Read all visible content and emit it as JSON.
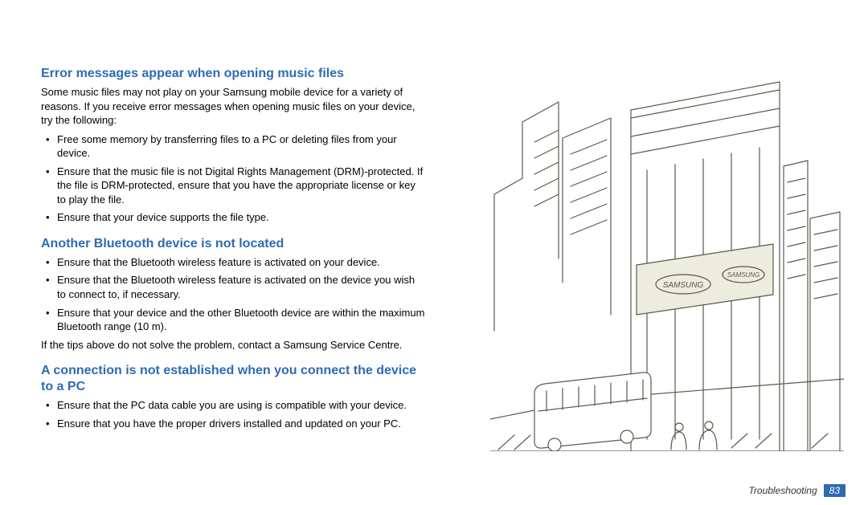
{
  "sections": {
    "s1": {
      "heading": "Error messages appear when opening music files",
      "intro": "Some music files may not play on your Samsung mobile device for a variety of reasons. If you receive error messages when opening music files on your device, try the following:",
      "bullets": [
        "Free some memory by transferring files to a PC or deleting files from your device.",
        "Ensure that the music file is not Digital Rights Management (DRM)-protected. If the file is DRM-protected, ensure that you have the appropriate license or key to play the file.",
        "Ensure that your device supports the file type."
      ]
    },
    "s2": {
      "heading": "Another Bluetooth device is not located",
      "bullets": [
        "Ensure that the Bluetooth wireless feature is activated on your device.",
        "Ensure that the Bluetooth wireless feature is activated on the device you wish to connect to, if necessary.",
        "Ensure that your device and the other Bluetooth device are within the maximum Bluetooth range (10 m)."
      ],
      "outro": "If the tips above do not solve the problem, contact a Samsung Service Centre."
    },
    "s3": {
      "heading": "A connection is not established when you connect the device to a PC",
      "bullets": [
        "Ensure that the PC data cable you are using is compatible with your device.",
        "Ensure that you have the proper drivers installed and updated on your PC."
      ]
    }
  },
  "footer": {
    "section": "Troubleshooting",
    "page": "83"
  },
  "illustration": {
    "description": "line-drawing-city-street-with-bus-and-samsung-billboards"
  }
}
